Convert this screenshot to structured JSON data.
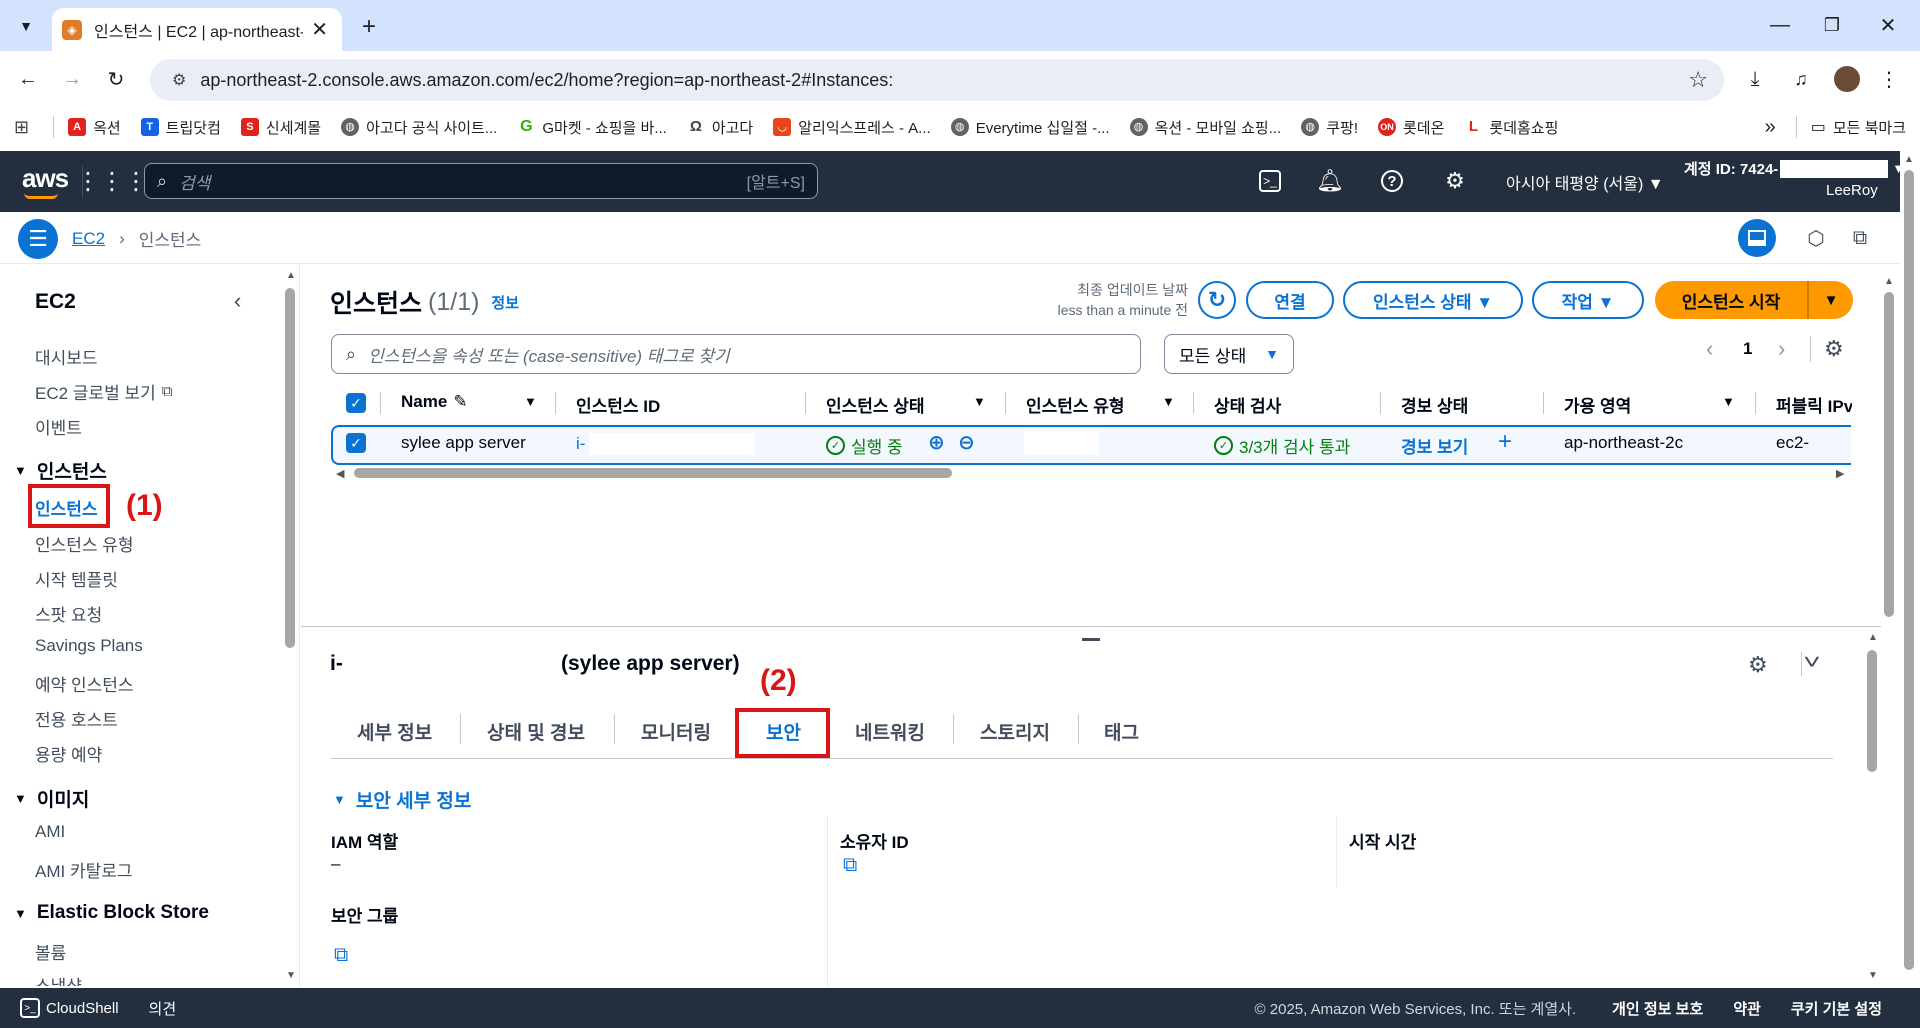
{
  "browser": {
    "tab_title": "인스턴스 | EC2 | ap-northeast-",
    "url": "ap-northeast-2.console.aws.amazon.com/ec2/home?region=ap-northeast-2#Instances:",
    "bookmarks": [
      "옥션",
      "트립닷컴",
      "신세계몰",
      "아고다 공식 사이트...",
      "G마켓 - 쇼핑을 바...",
      "아고다",
      "알리익스프레스 - A...",
      "Everytime 십일절 -...",
      "옥션 - 모바일 쇼핑...",
      "쿠팡!",
      "롯데온",
      "롯데홈쇼핑"
    ],
    "bookmarks_more": "»",
    "all_bookmarks": "모든 북마크"
  },
  "aws": {
    "logo": "aws",
    "search_placeholder": "검색",
    "search_shortcut": "[알트+S]",
    "region": "아시아 태평양 (서울) ▼",
    "account_id": "계정 ID: 7424-",
    "user": "LeeRoy"
  },
  "breadcrumb": {
    "root": "EC2",
    "current": "인스턴스"
  },
  "sidenav": {
    "title": "EC2",
    "top_items": [
      "대시보드",
      "EC2 글로벌 보기",
      "이벤트"
    ],
    "sections": [
      {
        "label": "인스턴스",
        "items": [
          "인스턴스",
          "인스턴스 유형",
          "시작 템플릿",
          "스팟 요청",
          "Savings Plans",
          "예약 인스턴스",
          "전용 호스트",
          "용량 예약"
        ]
      },
      {
        "label": "이미지",
        "items": [
          "AMI",
          "AMI 카탈로그"
        ]
      },
      {
        "label": "Elastic Block Store",
        "items": [
          "볼륨",
          "스냅샷"
        ]
      }
    ]
  },
  "annotations": {
    "step1": "(1)",
    "step2": "(2)"
  },
  "instances": {
    "title": "인스턴스",
    "count": "(1/1)",
    "info": "정보",
    "last_updated_label": "최종 업데이트 날짜",
    "last_updated_value": "less than a minute 전",
    "buttons": {
      "connect": "연결",
      "state": "인스턴스 상태 ▼",
      "actions": "작업 ▼",
      "launch": "인스턴스 시작"
    },
    "search_placeholder": "인스턴스을 속성 또는 (case-sensitive) 태그로 찾기",
    "filter": "모든 상태",
    "page": "1",
    "columns": [
      "Name",
      "인스턴스 ID",
      "인스턴스 상태",
      "인스턴스 유형",
      "상태 검사",
      "경보 상태",
      "가용 영역",
      "퍼블릭 IPv"
    ],
    "row": {
      "name": "sylee app server",
      "id": "i-",
      "state": "실행 중",
      "type": "",
      "status_check": "3/3개 검사 통과",
      "alarm": "경보 보기",
      "az": "ap-northeast-2c",
      "public_ip": "ec2-"
    }
  },
  "details": {
    "instance_id": "i-",
    "instance_name": "(sylee app server)",
    "tabs": [
      "세부 정보",
      "상태 및 경보",
      "모니터링",
      "보안",
      "네트워킹",
      "스토리지",
      "태그"
    ],
    "active_tab": "보안",
    "section_title": "보안 세부 정보",
    "fields": {
      "iam_label": "IAM 역할",
      "iam_value": "–",
      "owner_label": "소유자 ID",
      "launch_label": "시작 시간",
      "sg_label": "보안 그룹"
    }
  },
  "footer": {
    "cloudshell": "CloudShell",
    "feedback": "의견",
    "copyright": "© 2025, Amazon Web Services, Inc. 또는 계열사.",
    "privacy": "개인 정보 보호",
    "terms": "약관",
    "cookies": "쿠키 기본 설정"
  }
}
